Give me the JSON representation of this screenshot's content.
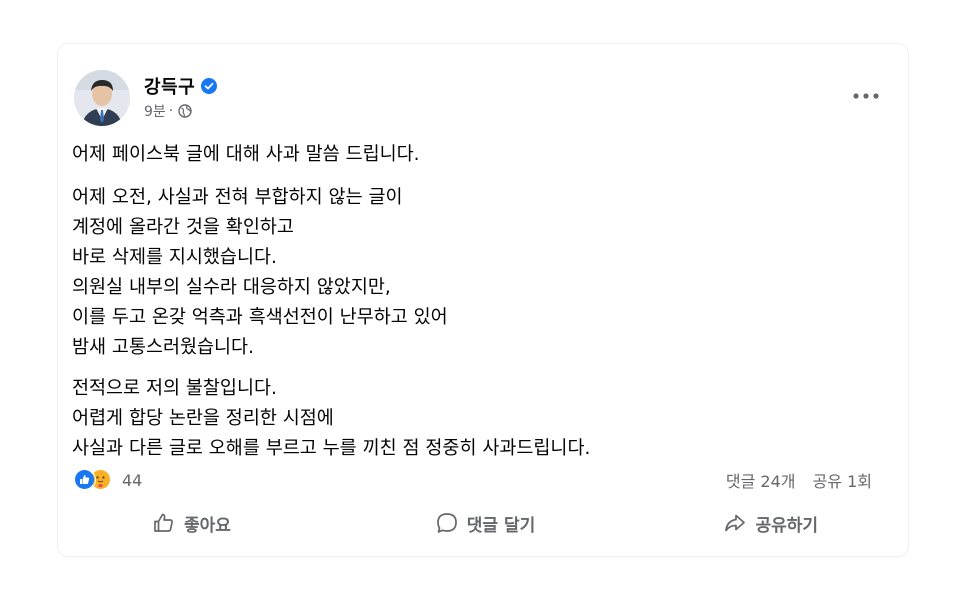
{
  "post": {
    "author": "강득구",
    "verified": true,
    "time": "9분",
    "audience_icon": "globe-icon",
    "more_icon": "more-horizontal-icon",
    "paragraphs": [
      [
        "어제 페이스북 글에 대해 사과 말씀 드립니다."
      ],
      [
        "어제 오전, 사실과 전혀 부합하지 않는 글이",
        "계정에 올라간 것을 확인하고",
        "바로 삭제를 지시했습니다.",
        "의원실 내부의 실수라 대응하지 않았지만,",
        "이를 두고 온갖 억측과 흑색선전이 난무하고 있어",
        "밤새 고통스러웠습니다."
      ],
      [
        "전적으로 저의 불찰입니다.",
        "어렵게 합당 논란을 정리한 시점에",
        "사실과 다른 글로 오해를 부르고 누를 끼친 점 정중히 사과드립니다."
      ]
    ]
  },
  "stats": {
    "reactions_count": "44",
    "comments": "댓글 24개",
    "shares": "공유 1회"
  },
  "actions": {
    "like": "좋아요",
    "comment": "댓글 달기",
    "share": "공유하기"
  },
  "colors": {
    "verified": "#1877f2",
    "like": "#1877f2",
    "care": "#f7b125",
    "secondary_text": "#65676b"
  }
}
